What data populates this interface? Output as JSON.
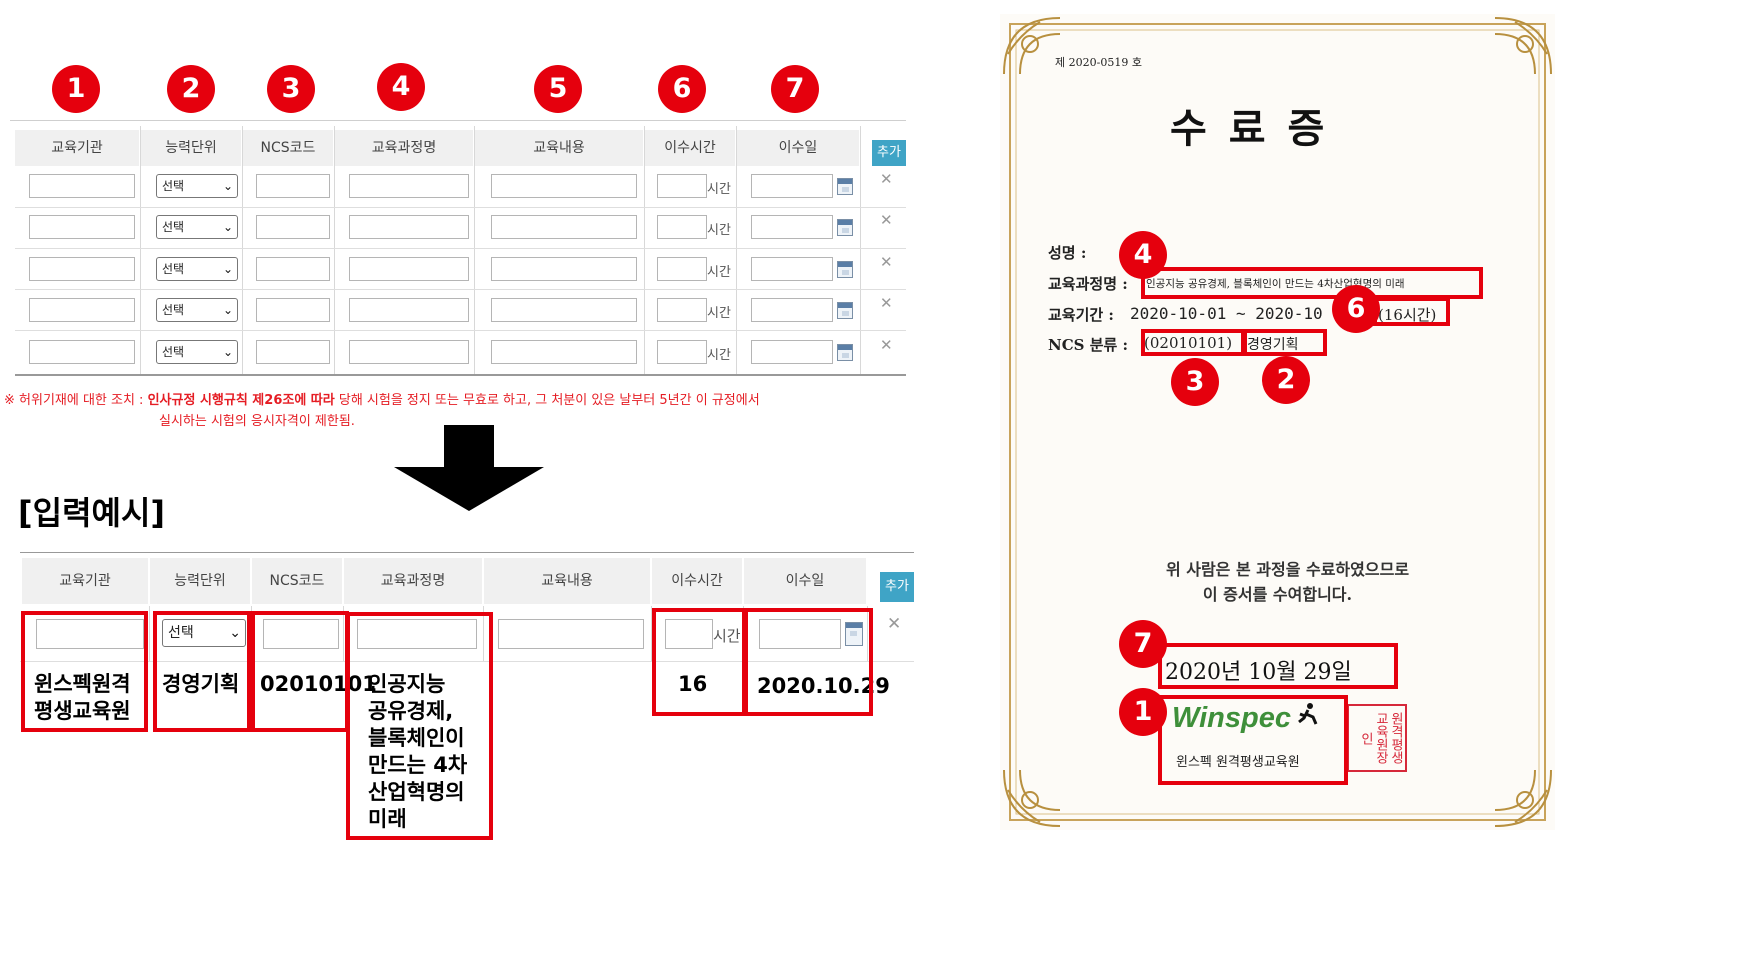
{
  "markers": [
    "1",
    "2",
    "3",
    "4",
    "5",
    "6",
    "7"
  ],
  "form": {
    "headers": [
      "교육기관",
      "능력단위",
      "NCS코드",
      "교육과정명",
      "교육내용",
      "이수시간",
      "이수일"
    ],
    "add_button": "추가",
    "select_default": "선택",
    "hours_unit": "시간",
    "row_count": 5
  },
  "notice": {
    "line1_prefix": "※ 허위기재에 대한 조치 : ",
    "line1_bold": "인사규정 시행규칙 제26조에 따라",
    "line1_rest": " 당해 시험을 정지 또는 무효로 하고, 그 처분이 있은 날부터 5년간 이 규정에서",
    "line2": "실시하는 시험의 응시자격이 제한됨."
  },
  "example": {
    "title": "[입력예시]",
    "headers": [
      "교육기관",
      "능력단위",
      "NCS코드",
      "교육과정명",
      "교육내용",
      "이수시간",
      "이수일"
    ],
    "add_button": "추가",
    "select_default": "선택",
    "hours_unit": "시간",
    "institution": [
      "윈스펙원격",
      "평생교육원"
    ],
    "unit": "경영기획",
    "ncs_code": "02010101",
    "course": [
      "인공지능",
      "공유경제,",
      "블록체인이",
      "만드는 4차",
      "산업혁명의",
      "미래"
    ],
    "hours": "16",
    "date": "2020.10.29"
  },
  "certificate": {
    "number": "제  2020-0519  호",
    "title": "수  료  증",
    "name_label": "성명 :",
    "course_label": "교육과정명 :",
    "course_value": "인공지능 공유경제, 블록체인이 만드는 4차산업혁명의 미래",
    "period_label": "교육기간 :",
    "period_value": "2020-10-01 ~ 2020-10",
    "period_hours": "(16시간)",
    "ncs_label": "NCS 분류 :",
    "ncs_code": "(02010101)",
    "ncs_unit": "경영기획",
    "body_line1": "위 사람은 본 과정을 수료하였으므로",
    "body_line2": "이 증서를 수여합니다.",
    "date": "2020년 10월 29일",
    "logo_text": "Winspec",
    "institution": "윈스펙 원격평생교육원",
    "seal": "원격평생교육원장인"
  },
  "colors": {
    "marker_red": "#e5000d",
    "add_button": "#3fa4c6",
    "gold_border": "#c8a35a"
  }
}
